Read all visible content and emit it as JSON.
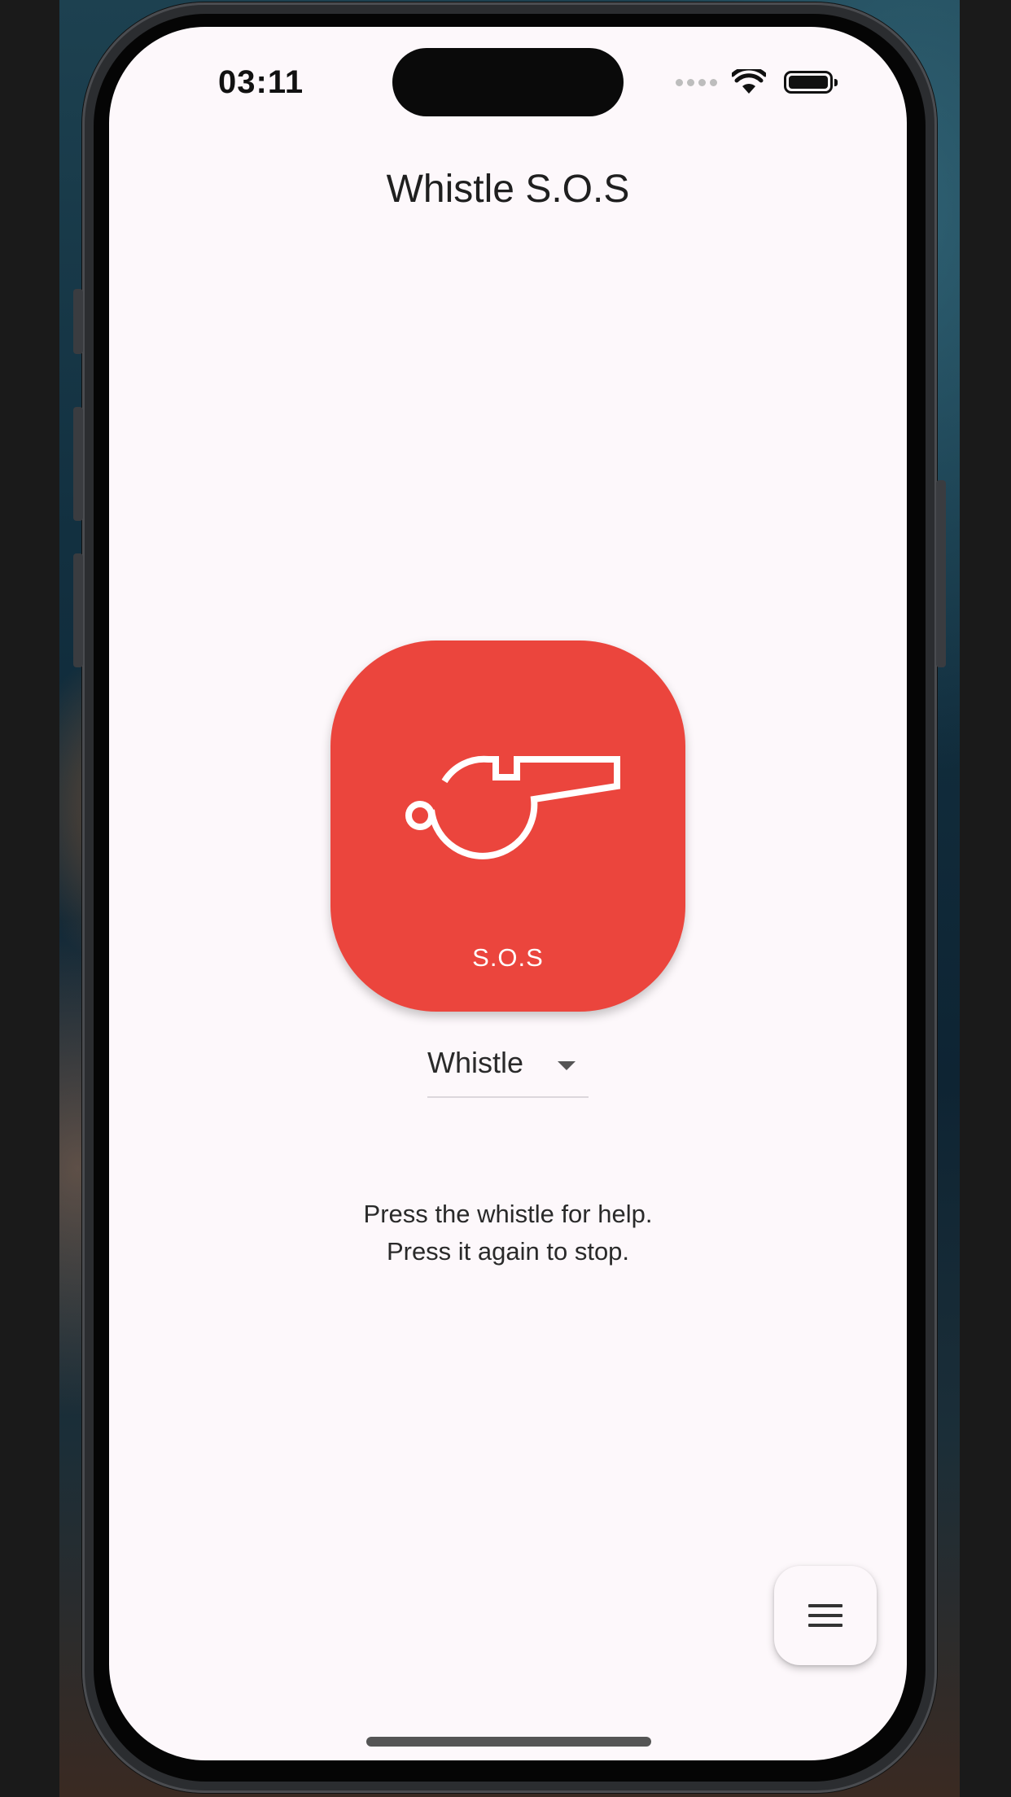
{
  "status_bar": {
    "time": "03:11"
  },
  "app": {
    "title": "Whistle S.O.S",
    "accent_color": "#eb453d",
    "background_color": "#fdf8fb"
  },
  "sos_button": {
    "label": "S.O.S",
    "icon": "whistle-icon"
  },
  "sound_select": {
    "selected": "Whistle"
  },
  "instructions": {
    "line1": "Press the whistle for help.",
    "line2": "Press it again to stop."
  },
  "menu_button": {
    "icon": "menu-icon"
  }
}
